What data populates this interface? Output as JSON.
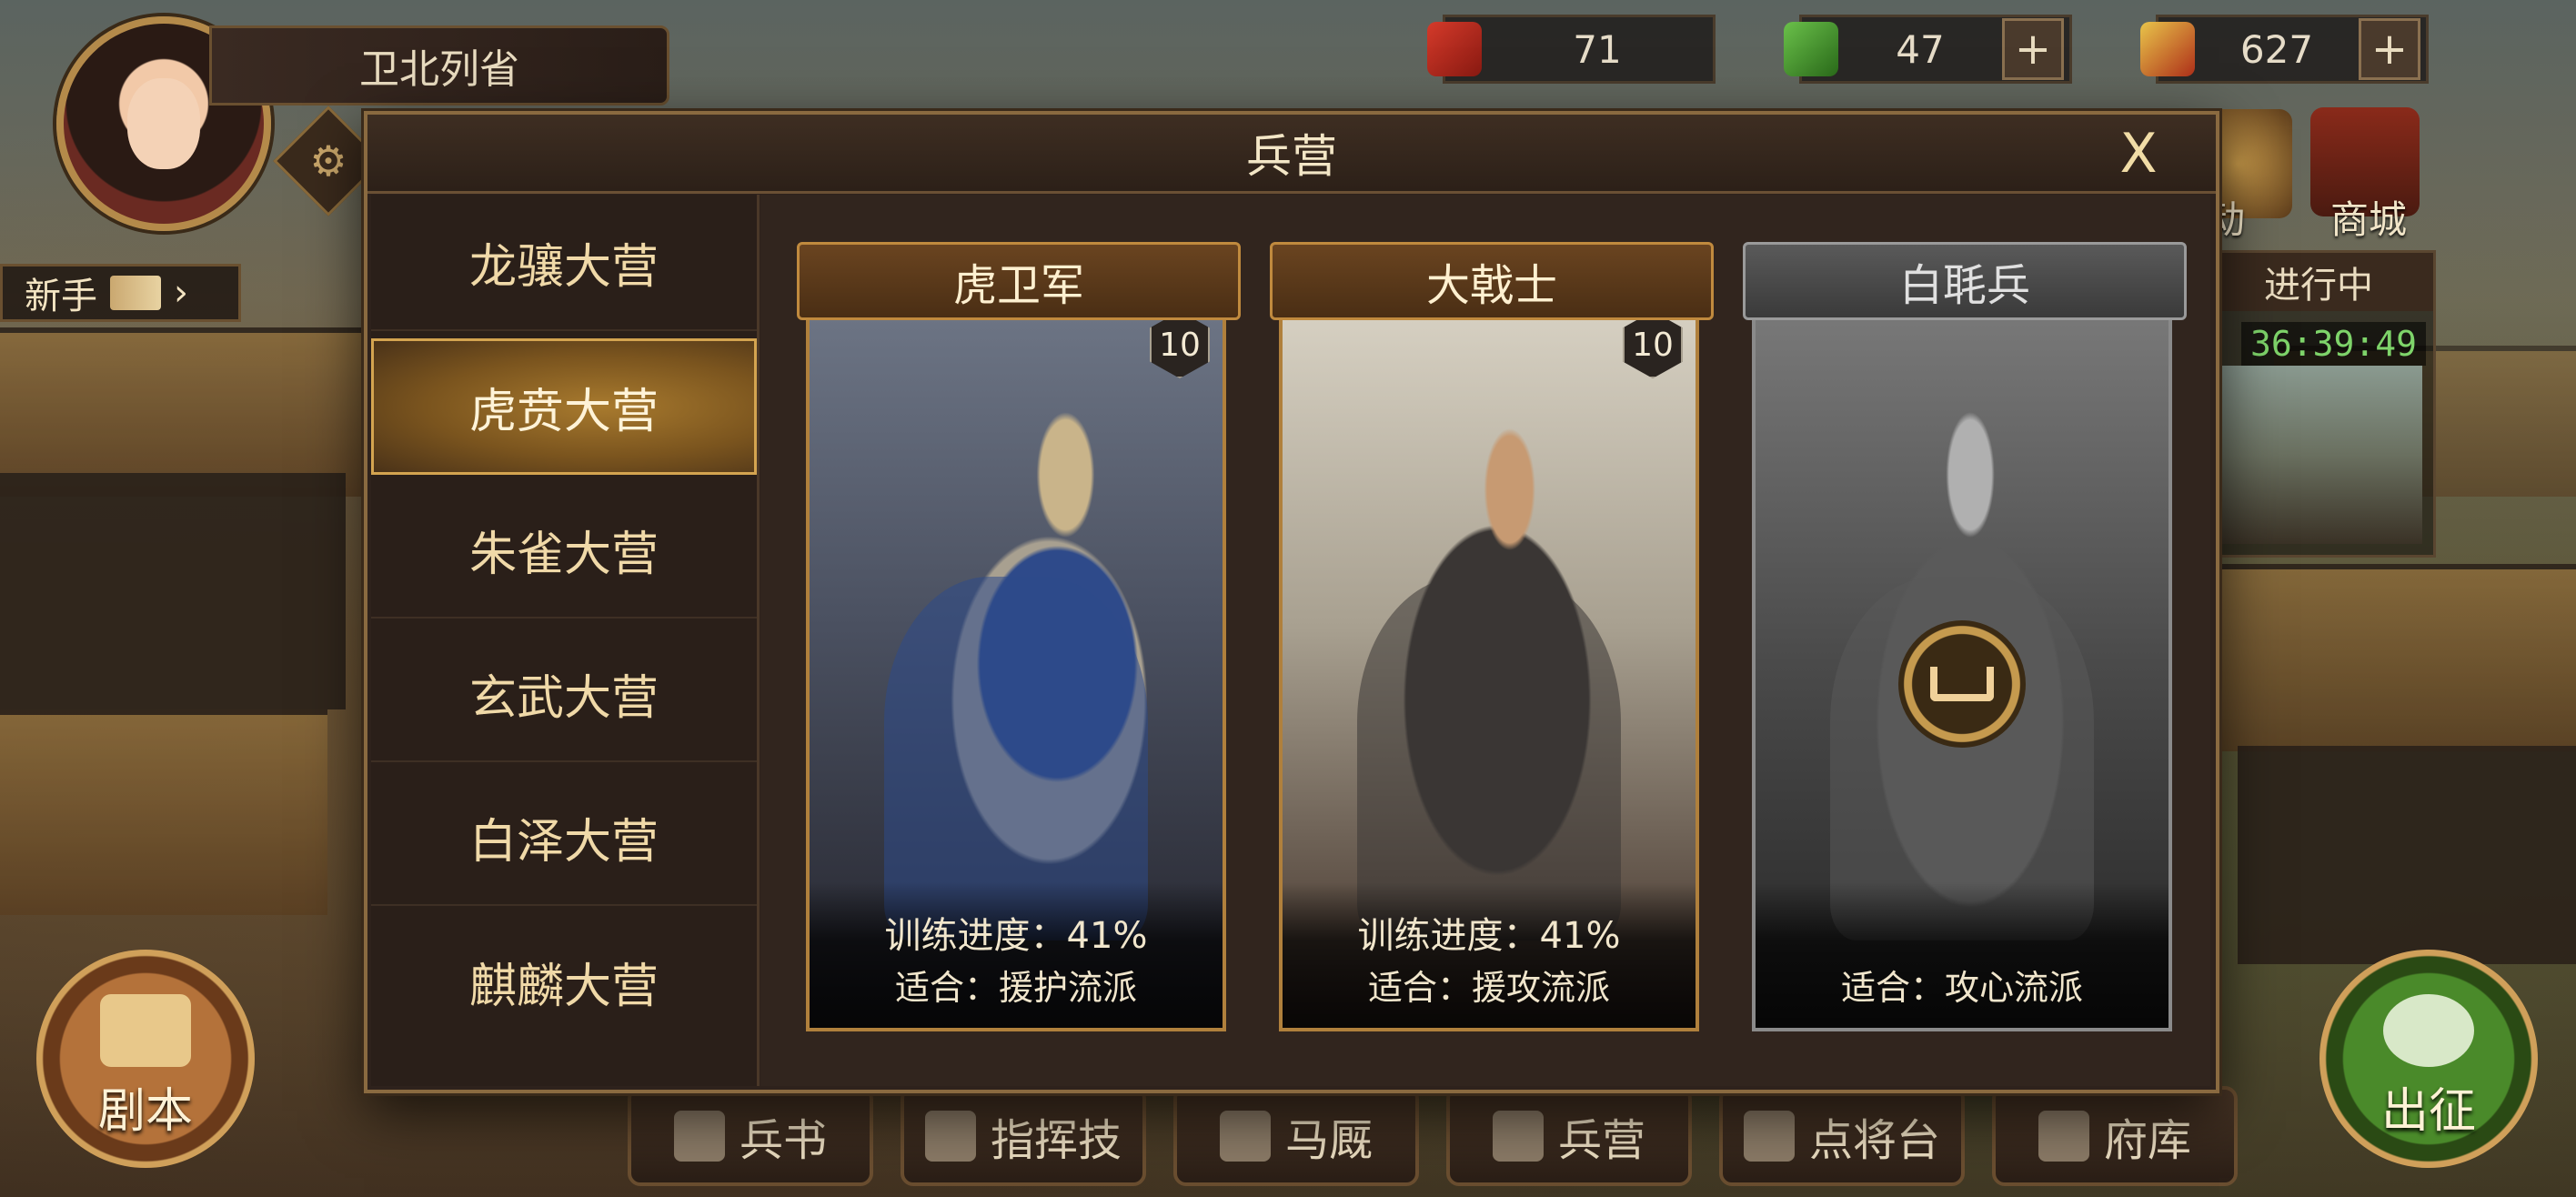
{
  "player": {
    "name": "卫北列省"
  },
  "newbie": {
    "label": "新手"
  },
  "resources": [
    {
      "icon": "red-token-icon",
      "value": "71",
      "has_plus": false
    },
    {
      "icon": "jade-icon",
      "value": "47",
      "has_plus": true
    },
    {
      "icon": "gold-ingot-icon",
      "value": "627",
      "has_plus": true
    }
  ],
  "right_panel": {
    "event_label": "动",
    "shop_label": "商城",
    "progress_title": "进行中",
    "timer": "36:39:49"
  },
  "dialog": {
    "title": "兵营",
    "close": "X",
    "tabs": [
      {
        "label": "龙骧大营",
        "active": false
      },
      {
        "label": "虎贲大营",
        "active": true
      },
      {
        "label": "朱雀大营",
        "active": false
      },
      {
        "label": "玄武大营",
        "active": false
      },
      {
        "label": "白泽大营",
        "active": false
      },
      {
        "label": "麒麟大营",
        "active": false
      }
    ],
    "units": [
      {
        "name": "虎卫军",
        "level": "10",
        "progress": "训练进度：41%",
        "suit": "适合：援护流派",
        "locked": false
      },
      {
        "name": "大戟士",
        "level": "10",
        "progress": "训练进度：41%",
        "suit": "适合：援攻流派",
        "locked": false
      },
      {
        "name": "白毦兵",
        "suit": "适合：攻心流派",
        "locked": true
      }
    ]
  },
  "bottom_bar": [
    {
      "label": "兵书",
      "icon": "book-icon"
    },
    {
      "label": "指挥技",
      "icon": "command-icon"
    },
    {
      "label": "马厩",
      "icon": "horse-icon"
    },
    {
      "label": "兵营",
      "icon": "barracks-icon"
    },
    {
      "label": "点将台",
      "icon": "general-platform-icon"
    },
    {
      "label": "府库",
      "icon": "treasury-icon"
    }
  ],
  "script_button": {
    "label": "剧本"
  },
  "expedition_button": {
    "label": "出征"
  },
  "colors": {
    "accent_gold": "#c08a3e",
    "timer_green": "#7ed46a",
    "active_tab": "#a87a2e"
  }
}
